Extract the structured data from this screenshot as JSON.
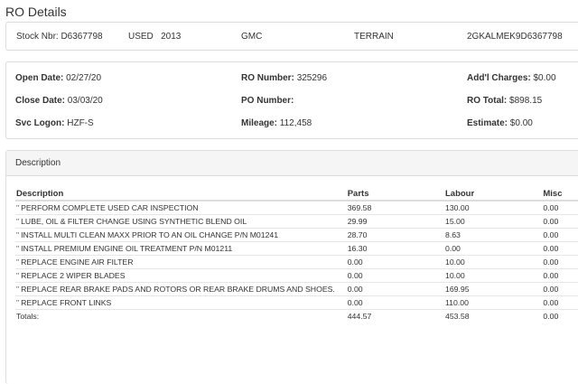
{
  "page": {
    "title": "RO Details"
  },
  "vehicle": {
    "stock_nbr": "Stock Nbr: D6367798",
    "condition_year": "USED   2013",
    "make": "GMC",
    "model": "TERRAIN",
    "vin": "2GKALMEK9D6367798"
  },
  "ro": {
    "open_date_label": "Open Date:",
    "open_date_value": "02/27/20",
    "close_date_label": "Close Date:",
    "close_date_value": "03/03/20",
    "svc_logon_label": "Svc Logon:",
    "svc_logon_value": "HZF-S",
    "ro_number_label": "RO Number:",
    "ro_number_value": "325296",
    "po_number_label": "PO Number:",
    "po_number_value": "",
    "mileage_label": "Mileage:",
    "mileage_value": "112,458",
    "addl_charges_label": "Add'l Charges:",
    "addl_charges_value": "$0.00",
    "ro_total_label": "RO Total:",
    "ro_total_value": "$898.15",
    "estimate_label": "Estimate:",
    "estimate_value": "$0.00"
  },
  "description_panel": {
    "heading": "Description",
    "columns": {
      "description": "Description",
      "parts": "Parts",
      "labour": "Labour",
      "misc": "Misc"
    },
    "row_marker": "\"",
    "rows": [
      {
        "description": "PERFORM COMPLETE USED CAR INSPECTION",
        "parts": "369.58",
        "labour": "130.00",
        "misc": "0.00"
      },
      {
        "description": "LUBE, OIL & FILTER CHANGE USING SYNTHETIC BLEND OIL",
        "parts": "29.99",
        "labour": "15.00",
        "misc": "0.00"
      },
      {
        "description": "INSTALL MULTI CLEAN MAXX PRIOR TO AN OIL CHANGE P/N M01241",
        "parts": "28.70",
        "labour": "8.63",
        "misc": "0.00"
      },
      {
        "description": "INSTALL PREMIUM ENGINE OIL TREATMENT P/N M01211",
        "parts": "16.30",
        "labour": "0.00",
        "misc": "0.00"
      },
      {
        "description": "REPLACE ENGINE AIR FILTER",
        "parts": "0.00",
        "labour": "10.00",
        "misc": "0.00"
      },
      {
        "description": "REPLACE 2 WIPER BLADES",
        "parts": "0.00",
        "labour": "10.00",
        "misc": "0.00"
      },
      {
        "description": "REPLACE REAR BRAKE PADS AND ROTORS OR REAR BRAKE DRUMS AND SHOES.",
        "parts": "0.00",
        "labour": "169.95",
        "misc": "0.00"
      },
      {
        "description": "REPLACE FRONT LINKS",
        "parts": "0.00",
        "labour": "110.00",
        "misc": "0.00"
      }
    ],
    "totals": {
      "label": "Totals:",
      "parts": "444.57",
      "labour": "453.58",
      "misc": "0.00"
    }
  }
}
